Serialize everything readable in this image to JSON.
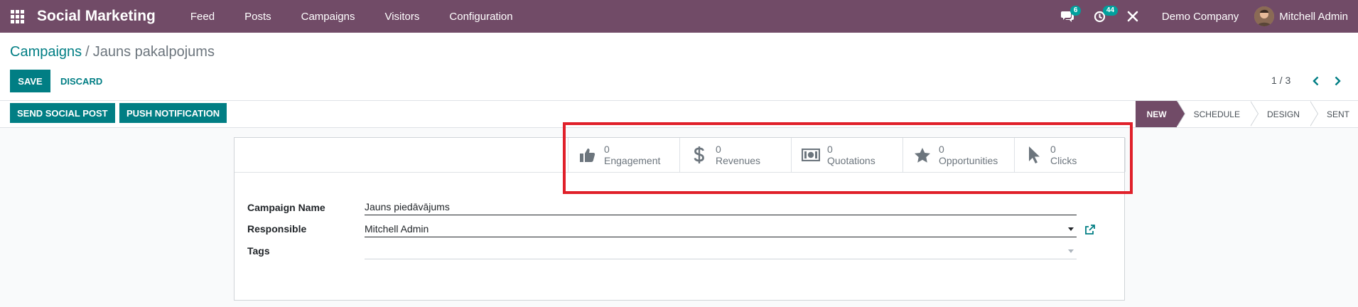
{
  "navbar": {
    "app_name": "Social Marketing",
    "menu": [
      "Feed",
      "Posts",
      "Campaigns",
      "Visitors",
      "Configuration"
    ],
    "chat_badge": "6",
    "activity_badge": "44",
    "company": "Demo Company",
    "user": "Mitchell Admin"
  },
  "breadcrumb": {
    "parent": "Campaigns",
    "separator": "/",
    "current": "Jauns pakalpojums"
  },
  "actions": {
    "save_label": "SAVE",
    "discard_label": "DISCARD"
  },
  "pager": {
    "value": "1 / 3"
  },
  "header_buttons": [
    "SEND SOCIAL POST",
    "PUSH NOTIFICATION"
  ],
  "stages": [
    {
      "label": "NEW",
      "active": true
    },
    {
      "label": "SCHEDULE",
      "active": false
    },
    {
      "label": "DESIGN",
      "active": false
    },
    {
      "label": "SENT",
      "active": false
    }
  ],
  "stat_buttons": [
    {
      "value": "0",
      "label": "Engagement",
      "icon": "thumbs-up-icon"
    },
    {
      "value": "0",
      "label": "Revenues",
      "icon": "dollar-icon"
    },
    {
      "value": "0",
      "label": "Quotations",
      "icon": "money-bill-icon"
    },
    {
      "value": "0",
      "label": "Opportunities",
      "icon": "star-icon"
    },
    {
      "value": "0",
      "label": "Clicks",
      "icon": "cursor-icon"
    }
  ],
  "form": {
    "campaign_name_label": "Campaign Name",
    "campaign_name_value": "Jauns piedāvājums",
    "responsible_label": "Responsible",
    "responsible_value": "Mitchell Admin",
    "tags_label": "Tags",
    "tags_value": ""
  },
  "colors": {
    "brand": "#714b67",
    "primary": "#017e84",
    "highlight": "#e0202a"
  }
}
